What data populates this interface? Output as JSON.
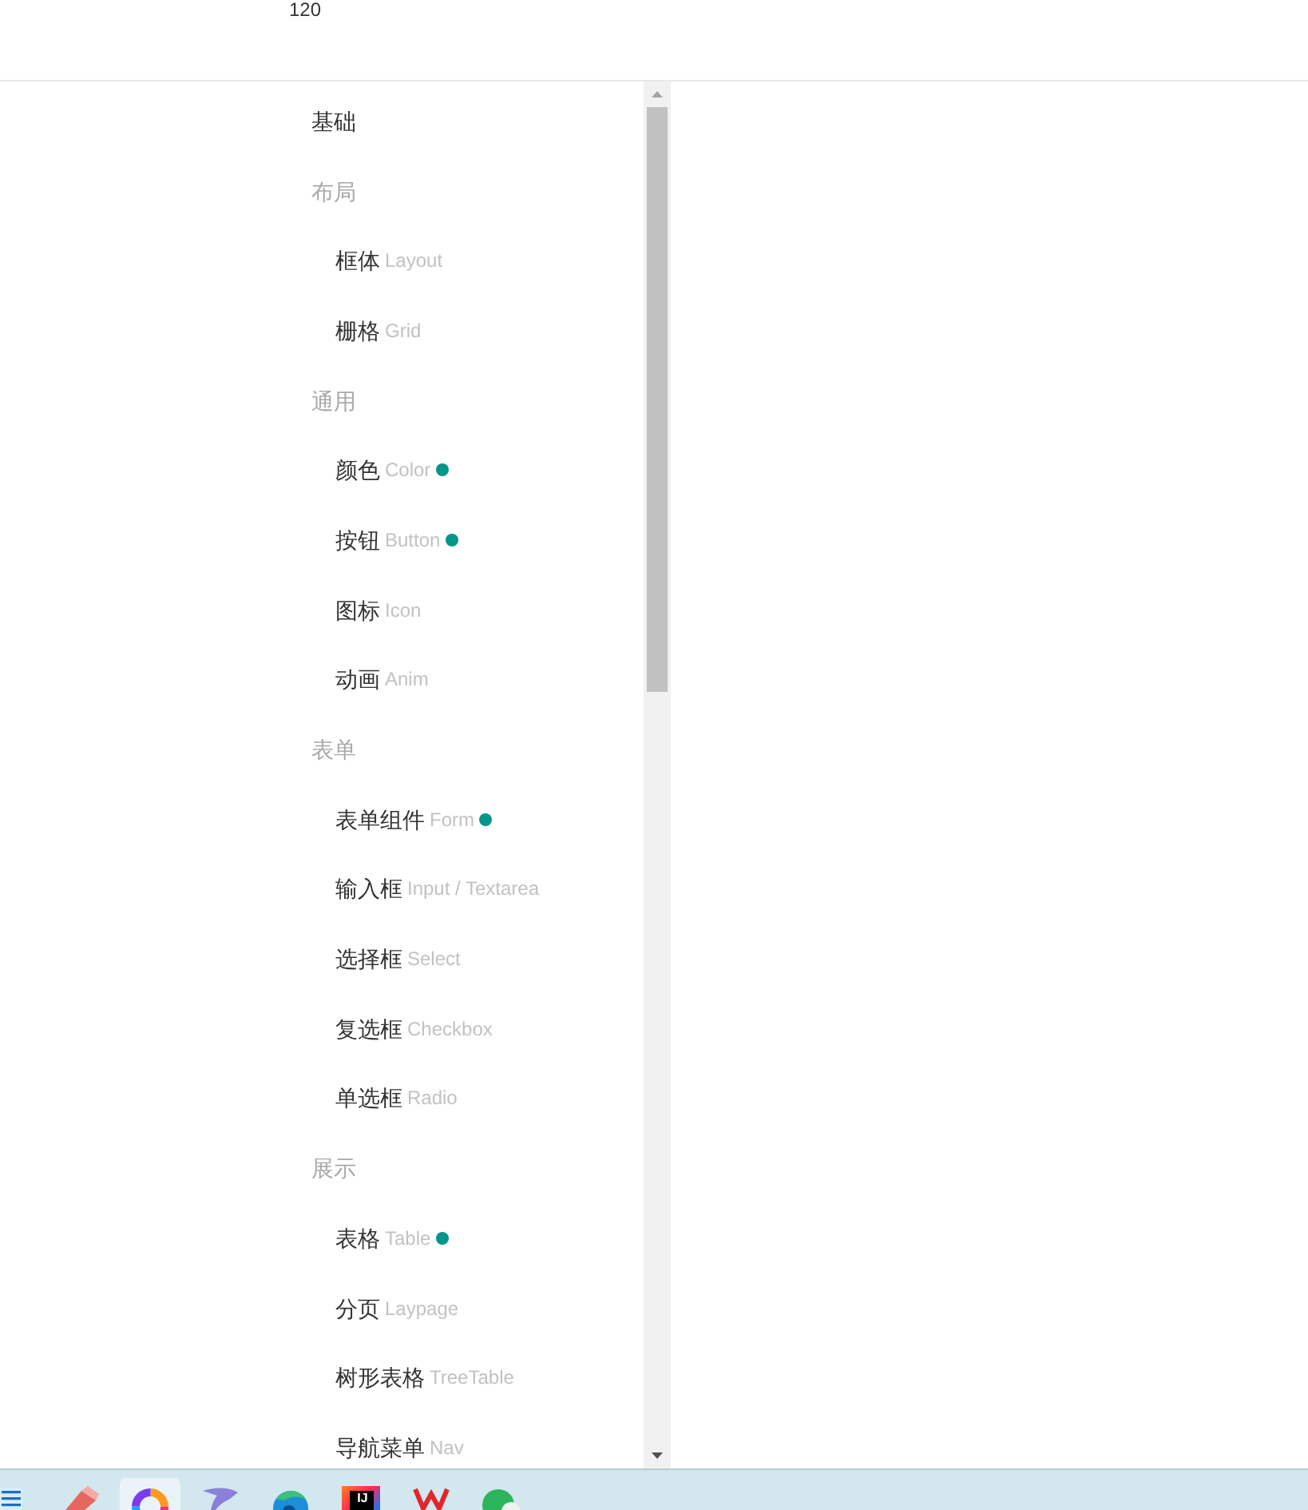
{
  "header": {
    "text": "120"
  },
  "nav": [
    {
      "kind": "section",
      "label": "基础"
    },
    {
      "kind": "group",
      "label": "布局",
      "children": [
        {
          "label": "框体",
          "sub": "Layout",
          "badge": false
        },
        {
          "label": "栅格",
          "sub": "Grid",
          "badge": false
        }
      ]
    },
    {
      "kind": "group",
      "label": "通用",
      "children": [
        {
          "label": "颜色",
          "sub": "Color",
          "badge": true
        },
        {
          "label": "按钮",
          "sub": "Button",
          "badge": true
        },
        {
          "label": "图标",
          "sub": "Icon",
          "badge": false
        },
        {
          "label": "动画",
          "sub": "Anim",
          "badge": false
        }
      ]
    },
    {
      "kind": "group",
      "label": "表单",
      "children": [
        {
          "label": "表单组件",
          "sub": "Form",
          "badge": true
        },
        {
          "label": "输入框",
          "sub": "Input / Textarea",
          "badge": false
        },
        {
          "label": "选择框",
          "sub": "Select",
          "badge": false
        },
        {
          "label": "复选框",
          "sub": "Checkbox",
          "badge": false
        },
        {
          "label": "单选框",
          "sub": "Radio",
          "badge": false
        }
      ]
    },
    {
      "kind": "group",
      "label": "展示",
      "children": [
        {
          "label": "表格",
          "sub": "Table",
          "badge": true
        },
        {
          "label": "分页",
          "sub": "Laypage",
          "badge": false
        },
        {
          "label": "树形表格",
          "sub": "TreeTable",
          "badge": false
        },
        {
          "label": "导航菜单",
          "sub": "Nav",
          "badge": false
        }
      ]
    }
  ],
  "taskbar": {
    "apps": [
      {
        "kind": "notes",
        "selected": false
      },
      {
        "kind": "eraser",
        "selected": false
      },
      {
        "kind": "ring",
        "selected": true
      },
      {
        "kind": "wing",
        "selected": false
      },
      {
        "kind": "browser",
        "selected": false
      },
      {
        "kind": "ide",
        "text": "IJ",
        "selected": false
      },
      {
        "kind": "office",
        "selected": false
      },
      {
        "kind": "chat",
        "selected": false
      }
    ]
  }
}
